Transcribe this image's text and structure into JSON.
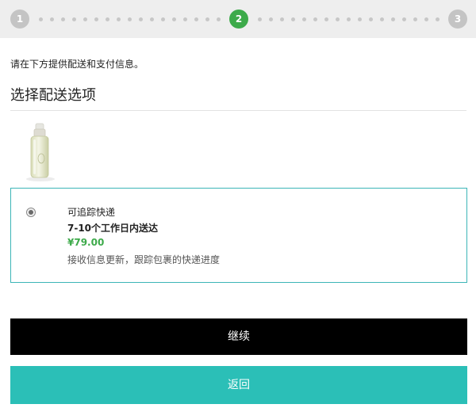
{
  "progress": {
    "steps": [
      "1",
      "2",
      "3"
    ],
    "current_step": 2,
    "colors": {
      "active": "#3daa4a",
      "inactive": "#c4c4c4",
      "dot": "#c7c7c7"
    }
  },
  "intro_text": "请在下方提供配送和支付信息。",
  "section_title": "选择配送选项",
  "product": {
    "image_icon": "perfume-bottle-icon"
  },
  "shipping_option": {
    "selected": true,
    "name": "可追踪快递",
    "delivery_time": "7-10个工作日内送达",
    "price": "¥79.00",
    "description": "接收信息更新，跟踪包裹的快递进度"
  },
  "buttons": {
    "continue_label": "继续",
    "back_label": "返回"
  },
  "colors": {
    "accent": "#2bbfb7",
    "price": "#3daa4a",
    "card_border": "#3cb5b7",
    "continue_bg": "#000000"
  }
}
